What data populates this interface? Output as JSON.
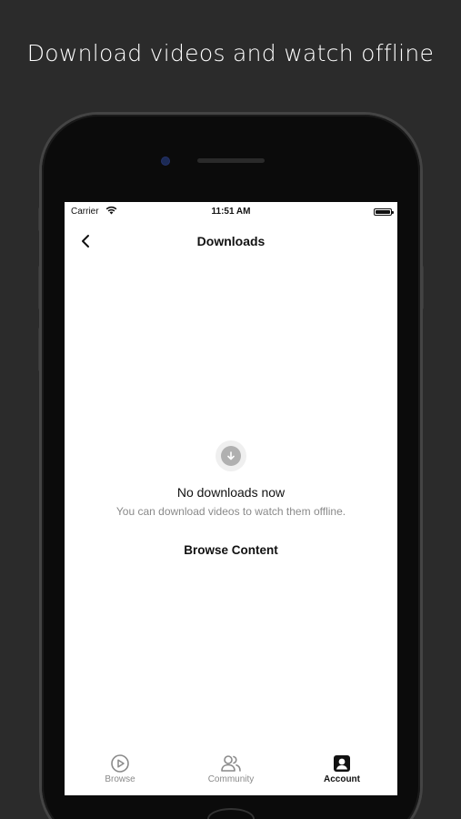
{
  "promo": {
    "headline": "Download videos and watch offline"
  },
  "status_bar": {
    "carrier": "Carrier",
    "time": "11:51 AM",
    "wifi_icon": "wifi-icon",
    "battery_icon": "battery-icon"
  },
  "nav": {
    "title": "Downloads",
    "back_icon": "chevron-left-icon"
  },
  "empty_state": {
    "icon": "download-arrow-icon",
    "title": "No downloads now",
    "subtitle": "You can download videos to watch them offline.",
    "action_label": "Browse Content"
  },
  "tabs": [
    {
      "label": "Browse",
      "icon": "play-circle-icon",
      "active": false
    },
    {
      "label": "Community",
      "icon": "users-icon",
      "active": false
    },
    {
      "label": "Account",
      "icon": "account-icon",
      "active": true
    }
  ],
  "colors": {
    "background": "#2b2b2b",
    "screen": "#ffffff",
    "text": "#111111",
    "muted": "#8a8a8a"
  }
}
